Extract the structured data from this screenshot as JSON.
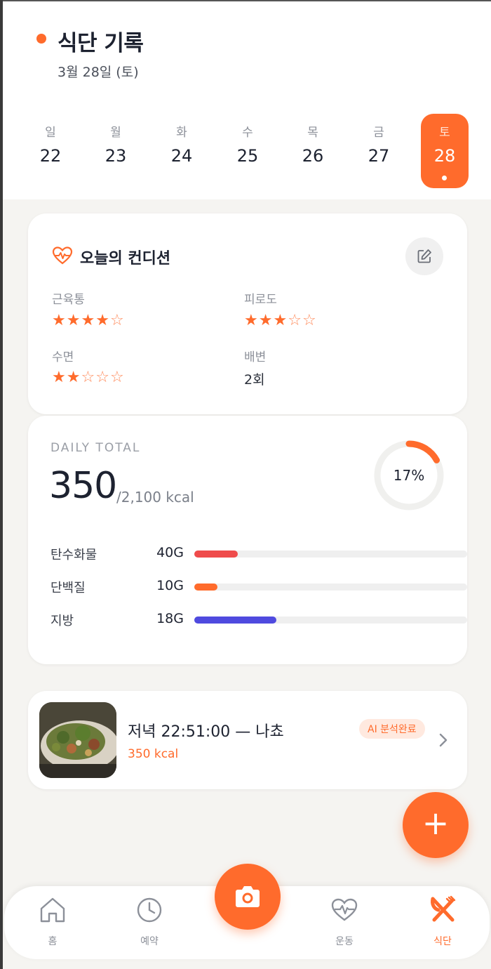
{
  "header": {
    "title": "식단 기록",
    "date": "3월 28일 (토)"
  },
  "week": [
    {
      "dow": "일",
      "num": "22"
    },
    {
      "dow": "월",
      "num": "23"
    },
    {
      "dow": "화",
      "num": "24"
    },
    {
      "dow": "수",
      "num": "25"
    },
    {
      "dow": "목",
      "num": "26"
    },
    {
      "dow": "금",
      "num": "27"
    },
    {
      "dow": "토",
      "num": "28",
      "selected": true
    }
  ],
  "condition": {
    "title": "오늘의 컨디션",
    "icon": "heart-pulse-icon",
    "edit_icon": "edit-icon",
    "muscle_pain": {
      "label": "근육통",
      "rating": 4,
      "max": 5
    },
    "fatigue": {
      "label": "피로도",
      "rating": 3,
      "max": 5
    },
    "sleep": {
      "label": "수면",
      "rating": 2,
      "max": 5
    },
    "bowel": {
      "label": "배변",
      "value": "2회"
    }
  },
  "daily_total": {
    "label": "DAILY TOTAL",
    "kcal": "350",
    "goal": "/2,100 kcal",
    "percent_text": "17%",
    "percent": 17,
    "macros": [
      {
        "name": "탄수화물",
        "value": "40G",
        "fill": 0.16,
        "color": "#ef4b4b"
      },
      {
        "name": "단백질",
        "value": "10G",
        "fill": 0.085,
        "color": "#ff6b2c"
      },
      {
        "name": "지방",
        "value": "18G",
        "fill": 0.3,
        "color": "#4f4adf"
      }
    ]
  },
  "meal": {
    "title": "저녁 22:51:00 — 나쵸",
    "kcal": "350 kcal",
    "badge": "AI 분석완료"
  },
  "fab": {
    "glyph": "+"
  },
  "nav": {
    "home": "홈",
    "booking": "예약",
    "exercise": "운동",
    "diet": "식단"
  },
  "colors": {
    "accent": "#ff6b2c",
    "carb": "#ef4b4b",
    "protein": "#ff6b2c",
    "fat": "#4f4adf"
  }
}
